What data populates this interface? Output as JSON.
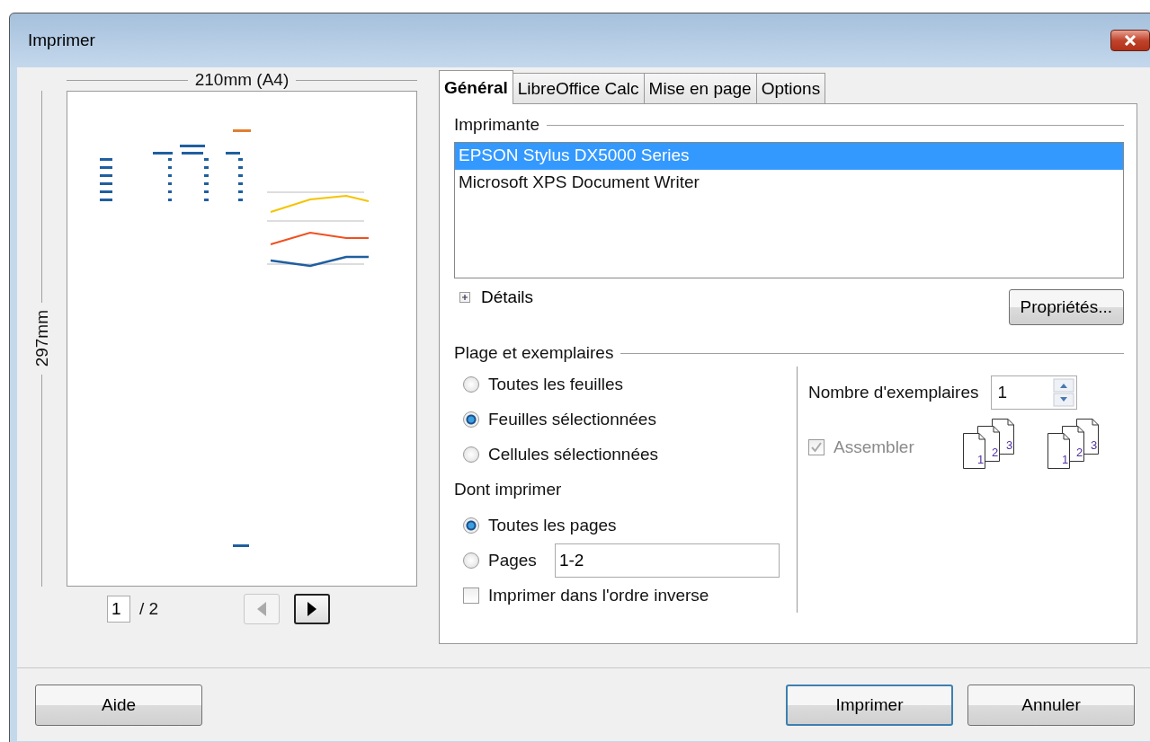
{
  "window": {
    "title": "Imprimer"
  },
  "preview": {
    "width_label": "210mm (A4)",
    "height_label": "297mm",
    "page": "1",
    "page_count": "/ 2",
    "prev_disabled": true,
    "next_disabled": false
  },
  "tabs": [
    {
      "label": "Général",
      "selected": true
    },
    {
      "label": "LibreOffice Calc",
      "selected": false
    },
    {
      "label": "Mise en page",
      "selected": false
    },
    {
      "label": "Options",
      "selected": false
    }
  ],
  "printer": {
    "heading": "Imprimante",
    "items": [
      {
        "name": "EPSON Stylus DX5000 Series",
        "selected": true
      },
      {
        "name": "Microsoft XPS Document Writer",
        "selected": false
      }
    ],
    "details": "Détails",
    "details_expanded": false,
    "properties_button": "Propriétés..."
  },
  "range": {
    "heading": "Plage et exemplaires",
    "sheet_options": [
      {
        "label": "Toutes les feuilles",
        "selected": false
      },
      {
        "label": "Feuilles sélectionnées",
        "selected": true
      },
      {
        "label": "Cellules sélectionnées",
        "selected": false
      }
    ],
    "print_heading": "Dont imprimer",
    "page_options": [
      {
        "label": "Toutes les pages",
        "selected": true
      },
      {
        "label": "Pages",
        "selected": false,
        "value": "1-2"
      }
    ],
    "reverse": {
      "label": "Imprimer dans l'ordre inverse",
      "checked": false
    }
  },
  "copies": {
    "label": "Nombre d'exemplaires",
    "value": "1",
    "collate": {
      "label": "Assembler",
      "checked": true,
      "disabled": true
    },
    "collate_icons": [
      {
        "pages": [
          "1",
          "2",
          "3"
        ]
      },
      {
        "pages": [
          "1",
          "2",
          "3"
        ]
      }
    ]
  },
  "buttons": {
    "help": "Aide",
    "print": "Imprimer",
    "cancel": "Annuler"
  }
}
